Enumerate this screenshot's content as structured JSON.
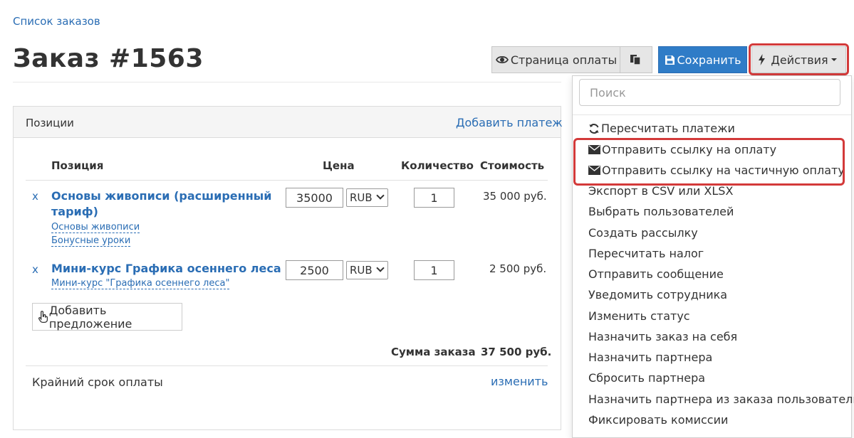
{
  "breadcrumb": "Список заказов",
  "title": "Заказ #1563",
  "toolbar": {
    "payment_page": "Страница оплаты",
    "save": "Сохранить",
    "actions": "Действия"
  },
  "panel": {
    "title": "Позиции",
    "add_payment": "Добавить платеж",
    "columns": [
      "Позиция",
      "Цена",
      "Количество",
      "Стоимость"
    ],
    "items": [
      {
        "remove": "x",
        "title_line1": "Основы живописи (расширенный",
        "title_line2": "тариф)",
        "subs": [
          "Основы живописи",
          "Бонусные уроки"
        ],
        "price": "35000",
        "currency": "RUB",
        "quantity": "1",
        "cost": "35 000 руб."
      },
      {
        "remove": "x",
        "title_line1": "Мини-курс Графика осеннего леса",
        "subs": [
          "Мини-курс \"Графика осеннего леса\""
        ],
        "price": "2500",
        "currency": "RUB",
        "quantity": "1",
        "cost": "2 500 руб."
      }
    ],
    "add_offer": "Добавить предложение",
    "sum_label": "Сумма заказа",
    "sum_value": "37 500 руб.",
    "deadline_label": "Крайний срок оплаты",
    "deadline_change": "изменить"
  },
  "dropdown": {
    "search_placeholder": "Поиск",
    "items": [
      "Пересчитать платежи",
      "Отправить ссылку на оплату",
      "Отправить ссылку на частичную оплату",
      "Экспорт в CSV или XLSX",
      "Выбрать пользователей",
      "Создать рассылку",
      "Пересчитать налог",
      "Отправить сообщение",
      "Уведомить сотрудника",
      "Изменить статус",
      "Назначить заказ на себя",
      "Назначить партнера",
      "Сбросить партнера",
      "Назначить партнера из заказа пользователю",
      "Фиксировать комиссии"
    ]
  },
  "colors": {
    "link": "#2a6db4",
    "primary_button": "#2f7cc7",
    "highlight": "#d33a3a"
  },
  "icons": [
    "eye-icon",
    "copy-icon",
    "floppy-disk-icon",
    "bolt-icon",
    "caret-down-icon",
    "refresh-icon",
    "envelope-icon",
    "hand-pointer-icon"
  ]
}
